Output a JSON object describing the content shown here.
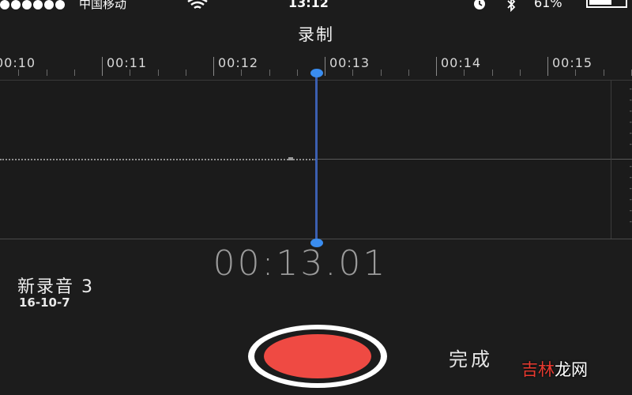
{
  "status_bar": {
    "carrier": "中国移动",
    "time": "13:12",
    "battery": "61%",
    "signal_icon": "signal-dots-icon",
    "wifi_icon": "wifi-icon",
    "alarm_icon": "alarm-clock-icon",
    "bluetooth_icon": "bluetooth-icon",
    "battery_level": 0.61
  },
  "nav": {
    "title": "录制"
  },
  "timeline": {
    "ticks": [
      "00:10",
      "00:11",
      "00:12",
      "00:13",
      "00:14",
      "00:15"
    ]
  },
  "recorder": {
    "elapsed": "00:13.01",
    "name": "新录音 3",
    "date": "16-10-7",
    "done_label": "完成"
  },
  "colors": {
    "background": "#1c1c1c",
    "playhead": "#3a8df0",
    "record": "#ef4a43"
  },
  "watermark": {
    "text_red": "吉林",
    "text_white": "龙网"
  }
}
